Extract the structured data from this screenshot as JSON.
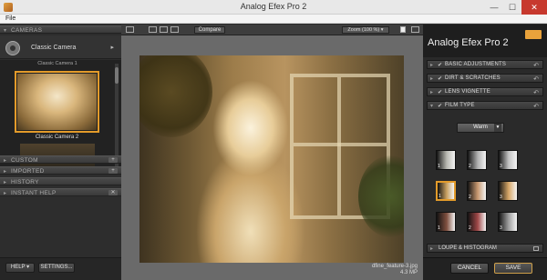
{
  "window": {
    "title": "Analog Efex Pro 2",
    "minimize": "—",
    "maximize": "☐",
    "close": "✕"
  },
  "menu": {
    "file": "File"
  },
  "left": {
    "cameras_label": "CAMERAS",
    "camera_name": "Classic Camera",
    "camera_arrow": "▸",
    "thumb_top_caption": "Classic Camera 1",
    "thumb_selected_caption": "Classic Camera 2",
    "sections": [
      "CUSTOM",
      "IMPORTED",
      "HISTORY",
      "INSTANT HELP"
    ],
    "help_label": "HELP ▾",
    "settings_label": "SETTINGS..."
  },
  "center": {
    "compare_label": "Compare",
    "zoom_label": "Zoom (100 %) ▾",
    "file_name": "dfine_feature-3.jpg",
    "file_size": "4.3 MP"
  },
  "right": {
    "brand": "Analog Efex Pro 2",
    "sections": [
      {
        "label": "BASIC ADJUSTMENTS",
        "check": "✔"
      },
      {
        "label": "DIRT & SCRATCHES",
        "check": "✔"
      },
      {
        "label": "LENS VIGNETTE",
        "check": "✔"
      },
      {
        "label": "FILM TYPE",
        "check": "✔"
      }
    ],
    "reset_icon": "↶",
    "film_dropdown": "Warm",
    "swatches": [
      {
        "n": "1",
        "color": "#b8b8b0"
      },
      {
        "n": "2",
        "color": "#b0b0b0"
      },
      {
        "n": "3",
        "color": "#c4c4c4"
      },
      {
        "n": "1",
        "color": "#c8a060"
      },
      {
        "n": "2",
        "color": "#c89870"
      },
      {
        "n": "3",
        "color": "#d8a868"
      },
      {
        "n": "1",
        "color": "#805040"
      },
      {
        "n": "2",
        "color": "#a04848"
      },
      {
        "n": "3",
        "color": "#a0a0a0"
      }
    ],
    "loupe_label": "LOUPE & HISTOGRAM",
    "cancel_label": "CANCEL",
    "save_label": "SAVE"
  }
}
